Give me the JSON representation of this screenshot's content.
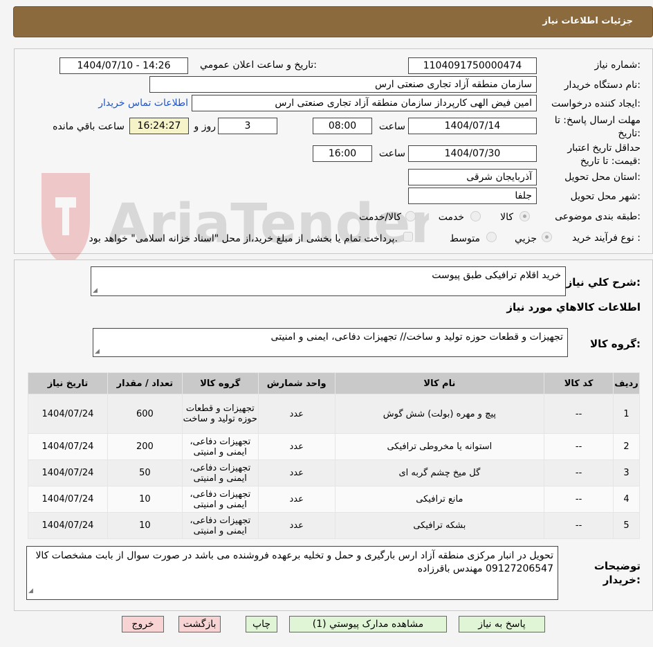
{
  "header": {
    "title": "جزئیات اطلاعات نیاز"
  },
  "watermark": {
    "text": "AriaTender.neT"
  },
  "info": {
    "need_number_label": "شماره نیاز:",
    "need_number": "1104091750000474",
    "announce_label": "تاریخ و ساعت اعلان عمومي:",
    "announce_value": "1404/07/10 - 14:26",
    "buyer_org_label": "نام دستگاه خريدار:",
    "buyer_org": "سازمان منطقه آزاد تجاری صنعتی ارس",
    "requester_label": "ايجاد كننده درخواست:",
    "requester": "امین فیض الهی کارپرداز سازمان منطقه آزاد تجاری صنعتی ارس",
    "contact_link": "اطلاعات تماس خريدار",
    "deadline_label": "مهلت ارسال پاسخ: تا تاريخ:",
    "deadline_date": "1404/07/14",
    "time_label": "ساعت",
    "deadline_time": "08:00",
    "days_value": "3",
    "days_label": "روز و",
    "remaining_time": "16:24:27",
    "remaining_label": "ساعت باقي مانده",
    "validity_label": "حداقل تاريخ اعتبار قيمت: تا تاريخ:",
    "validity_date": "1404/07/30",
    "validity_time": "16:00",
    "province_label": "استان محل تحويل:",
    "province": "آذربایجان شرقی",
    "city_label": "شهر محل تحويل:",
    "city": "جلفا",
    "category_label": "طبقه بندی موضوعی:",
    "category_options": [
      "کالا",
      "خدمت",
      "کالا/خدمت"
    ],
    "process_label": "نوع فرآيند خريد :",
    "process_options": [
      "جزيي",
      "متوسط"
    ],
    "payment_note": "پرداخت تمام يا بخشی از مبلغ خريد،از محل \"اسناد خزانه اسلامی\" خواهد بود."
  },
  "details": {
    "summary_label": "شرح كلي نياز:",
    "summary": "خريد اقلام ترافيکی طبق پيوست",
    "goods_info_title": "اطلاعات كالاهاي مورد نياز",
    "goods_group_label": "گروه کالا:",
    "goods_group": "تجهیزات و قطعات حوزه تولید و ساخت// تجهیزات دفاعی، ایمنی و امنیتی",
    "columns": [
      "رديف",
      "کد کالا",
      "نام کالا",
      "واحد شمارش",
      "گروه کالا",
      "تعداد / مقدار",
      "تاریخ نیاز"
    ],
    "rows": [
      {
        "row": "1",
        "code": "--",
        "name": "پیچ و مهره (بولت) شش گوش",
        "unit": "عدد",
        "group": "تجهیزات و قطعات حوزه تولید و ساخت",
        "qty": "600",
        "date": "1404/07/24"
      },
      {
        "row": "2",
        "code": "--",
        "name": "استوانه یا مخروطی ترافیکی",
        "unit": "عدد",
        "group": "تجهیزات دفاعی، ایمنی و امنیتی",
        "qty": "200",
        "date": "1404/07/24"
      },
      {
        "row": "3",
        "code": "--",
        "name": "گل میخ چشم گربه ای",
        "unit": "عدد",
        "group": "تجهیزات دفاعی، ایمنی و امنیتی",
        "qty": "50",
        "date": "1404/07/24"
      },
      {
        "row": "4",
        "code": "--",
        "name": "مانع ترافیکی",
        "unit": "عدد",
        "group": "تجهیزات دفاعی، ایمنی و امنیتی",
        "qty": "10",
        "date": "1404/07/24"
      },
      {
        "row": "5",
        "code": "--",
        "name": "بشکه ترافیکی",
        "unit": "عدد",
        "group": "تجهیزات دفاعی، ایمنی و امنیتی",
        "qty": "10",
        "date": "1404/07/24"
      }
    ],
    "buyer_notes_label": "توضيحات خريدار:",
    "buyer_notes": "تحویل در انبار مرکزی منطقه آزاد ارس بارگیری و حمل و تخلیه برعهده فروشنده می باشد در صورت سوال از بابت مشخصات کالا 09127206547 مهندس باقرزاده"
  },
  "buttons": {
    "reply": "پاسخ به نياز",
    "attachments": "مشاهده مدارک پيوستي (1)",
    "print": "چاپ",
    "back": "بازگشت",
    "exit": "خروج"
  }
}
